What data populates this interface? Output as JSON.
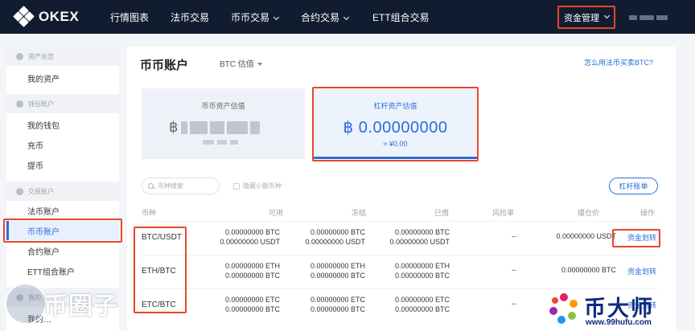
{
  "nav": {
    "logo_text": "OKEX",
    "items": [
      "行情图表",
      "法币交易",
      "币币交易",
      "合约交易",
      "ETT组合交易"
    ],
    "funds_label": "资金管理"
  },
  "sidebar": {
    "sections": [
      {
        "title": "资产总览",
        "items": [
          "我的资产"
        ]
      },
      {
        "title": "钱包账户",
        "items": [
          "我的钱包",
          "充币",
          "提币"
        ]
      },
      {
        "title": "交易账户",
        "items": [
          "法币账户",
          "币币账户",
          "合约账户",
          "ETT组合账户"
        ]
      },
      {
        "title": "我的…",
        "items": [
          "我的…"
        ]
      }
    ],
    "active_item": "币币账户"
  },
  "main": {
    "title": "币币账户",
    "estimate_select": "BTC 估值",
    "help_link": "怎么用法币买卖BTC?",
    "spot_card": {
      "label": "币币资产估值",
      "currency_symbol": "฿"
    },
    "margin_card": {
      "label": "杠杆资产估值",
      "value": "฿ 0.00000000",
      "sub": "≈ ¥0.00"
    },
    "search_placeholder": "币种搜索",
    "hide_small_label": "隐藏小额币种",
    "ledger_button": "杠杆账单",
    "columns": [
      "币种",
      "可用",
      "冻结",
      "已借",
      "风险率",
      "爆仓价",
      "操作"
    ],
    "rows": [
      {
        "pair": "BTC/USDT",
        "available": [
          "0.00000000 BTC",
          "0.00000000 USDT"
        ],
        "frozen": [
          "0.00000000 BTC",
          "0.00000000 USDT"
        ],
        "borrowed": [
          "0.00000000 BTC",
          "0.00000000 USDT"
        ],
        "risk": "--",
        "liq_price": "0.00000000 USDT",
        "action": "资金划转"
      },
      {
        "pair": "ETH/BTC",
        "available": [
          "0.00000000 ETH",
          "0.00000000 BTC"
        ],
        "frozen": [
          "0.00000000 ETH",
          "0.00000000 BTC"
        ],
        "borrowed": [
          "0.00000000 ETH",
          "0.00000000 BTC"
        ],
        "risk": "--",
        "liq_price": "0.00000000 BTC",
        "action": "资金划转"
      },
      {
        "pair": "ETC/BTC",
        "available": [
          "0.00000000 ETC",
          "0.00000000 BTC"
        ],
        "frozen": [
          "0.00000000 ETC",
          "0.00000000 BTC"
        ],
        "borrowed": [
          "0.00000000 ETC",
          "0.00000000 BTC"
        ],
        "risk": "--",
        "liq_price": "",
        "action": "资金划转"
      }
    ]
  },
  "watermarks": {
    "left_text": "币圈子",
    "right_text": "币大师",
    "right_url": "www.99hufu.com"
  },
  "colors": {
    "nav_bg": "#121c31",
    "accent": "#2b6ed7",
    "highlight": "#e8462b"
  }
}
